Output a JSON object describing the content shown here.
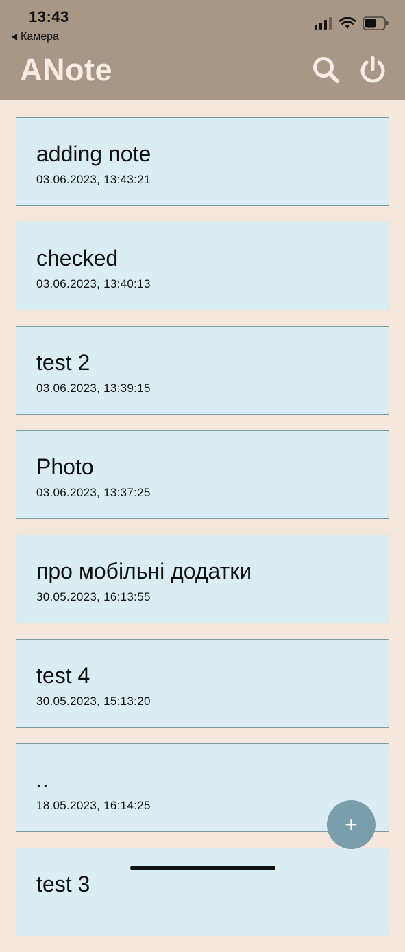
{
  "status_bar": {
    "time": "13:43",
    "back_label": "Камера",
    "battery_level": 0.6
  },
  "header": {
    "title": "ANote",
    "search_icon": "search-icon",
    "power_icon": "power-icon"
  },
  "notes": [
    {
      "title": "adding note",
      "date": "03.06.2023, 13:43:21"
    },
    {
      "title": "checked",
      "date": "03.06.2023, 13:40:13"
    },
    {
      "title": "test 2",
      "date": "03.06.2023, 13:39:15"
    },
    {
      "title": "Photo",
      "date": "03.06.2023, 13:37:25"
    },
    {
      "title": "про мобільні додатки",
      "date": "30.05.2023, 16:13:55"
    },
    {
      "title": "test 4",
      "date": "30.05.2023, 15:13:20"
    },
    {
      "title": "..",
      "date": "18.05.2023, 16:14:25"
    },
    {
      "title": "test 3",
      "date": ""
    }
  ],
  "fab": {
    "label": "+"
  },
  "colors": {
    "header_bg": "#a89787",
    "page_bg": "#f4e7dd",
    "card_bg": "#daedf3",
    "card_border": "#7a9aa5",
    "fab_bg": "#7a9eab",
    "title_color": "#f6ece3"
  }
}
